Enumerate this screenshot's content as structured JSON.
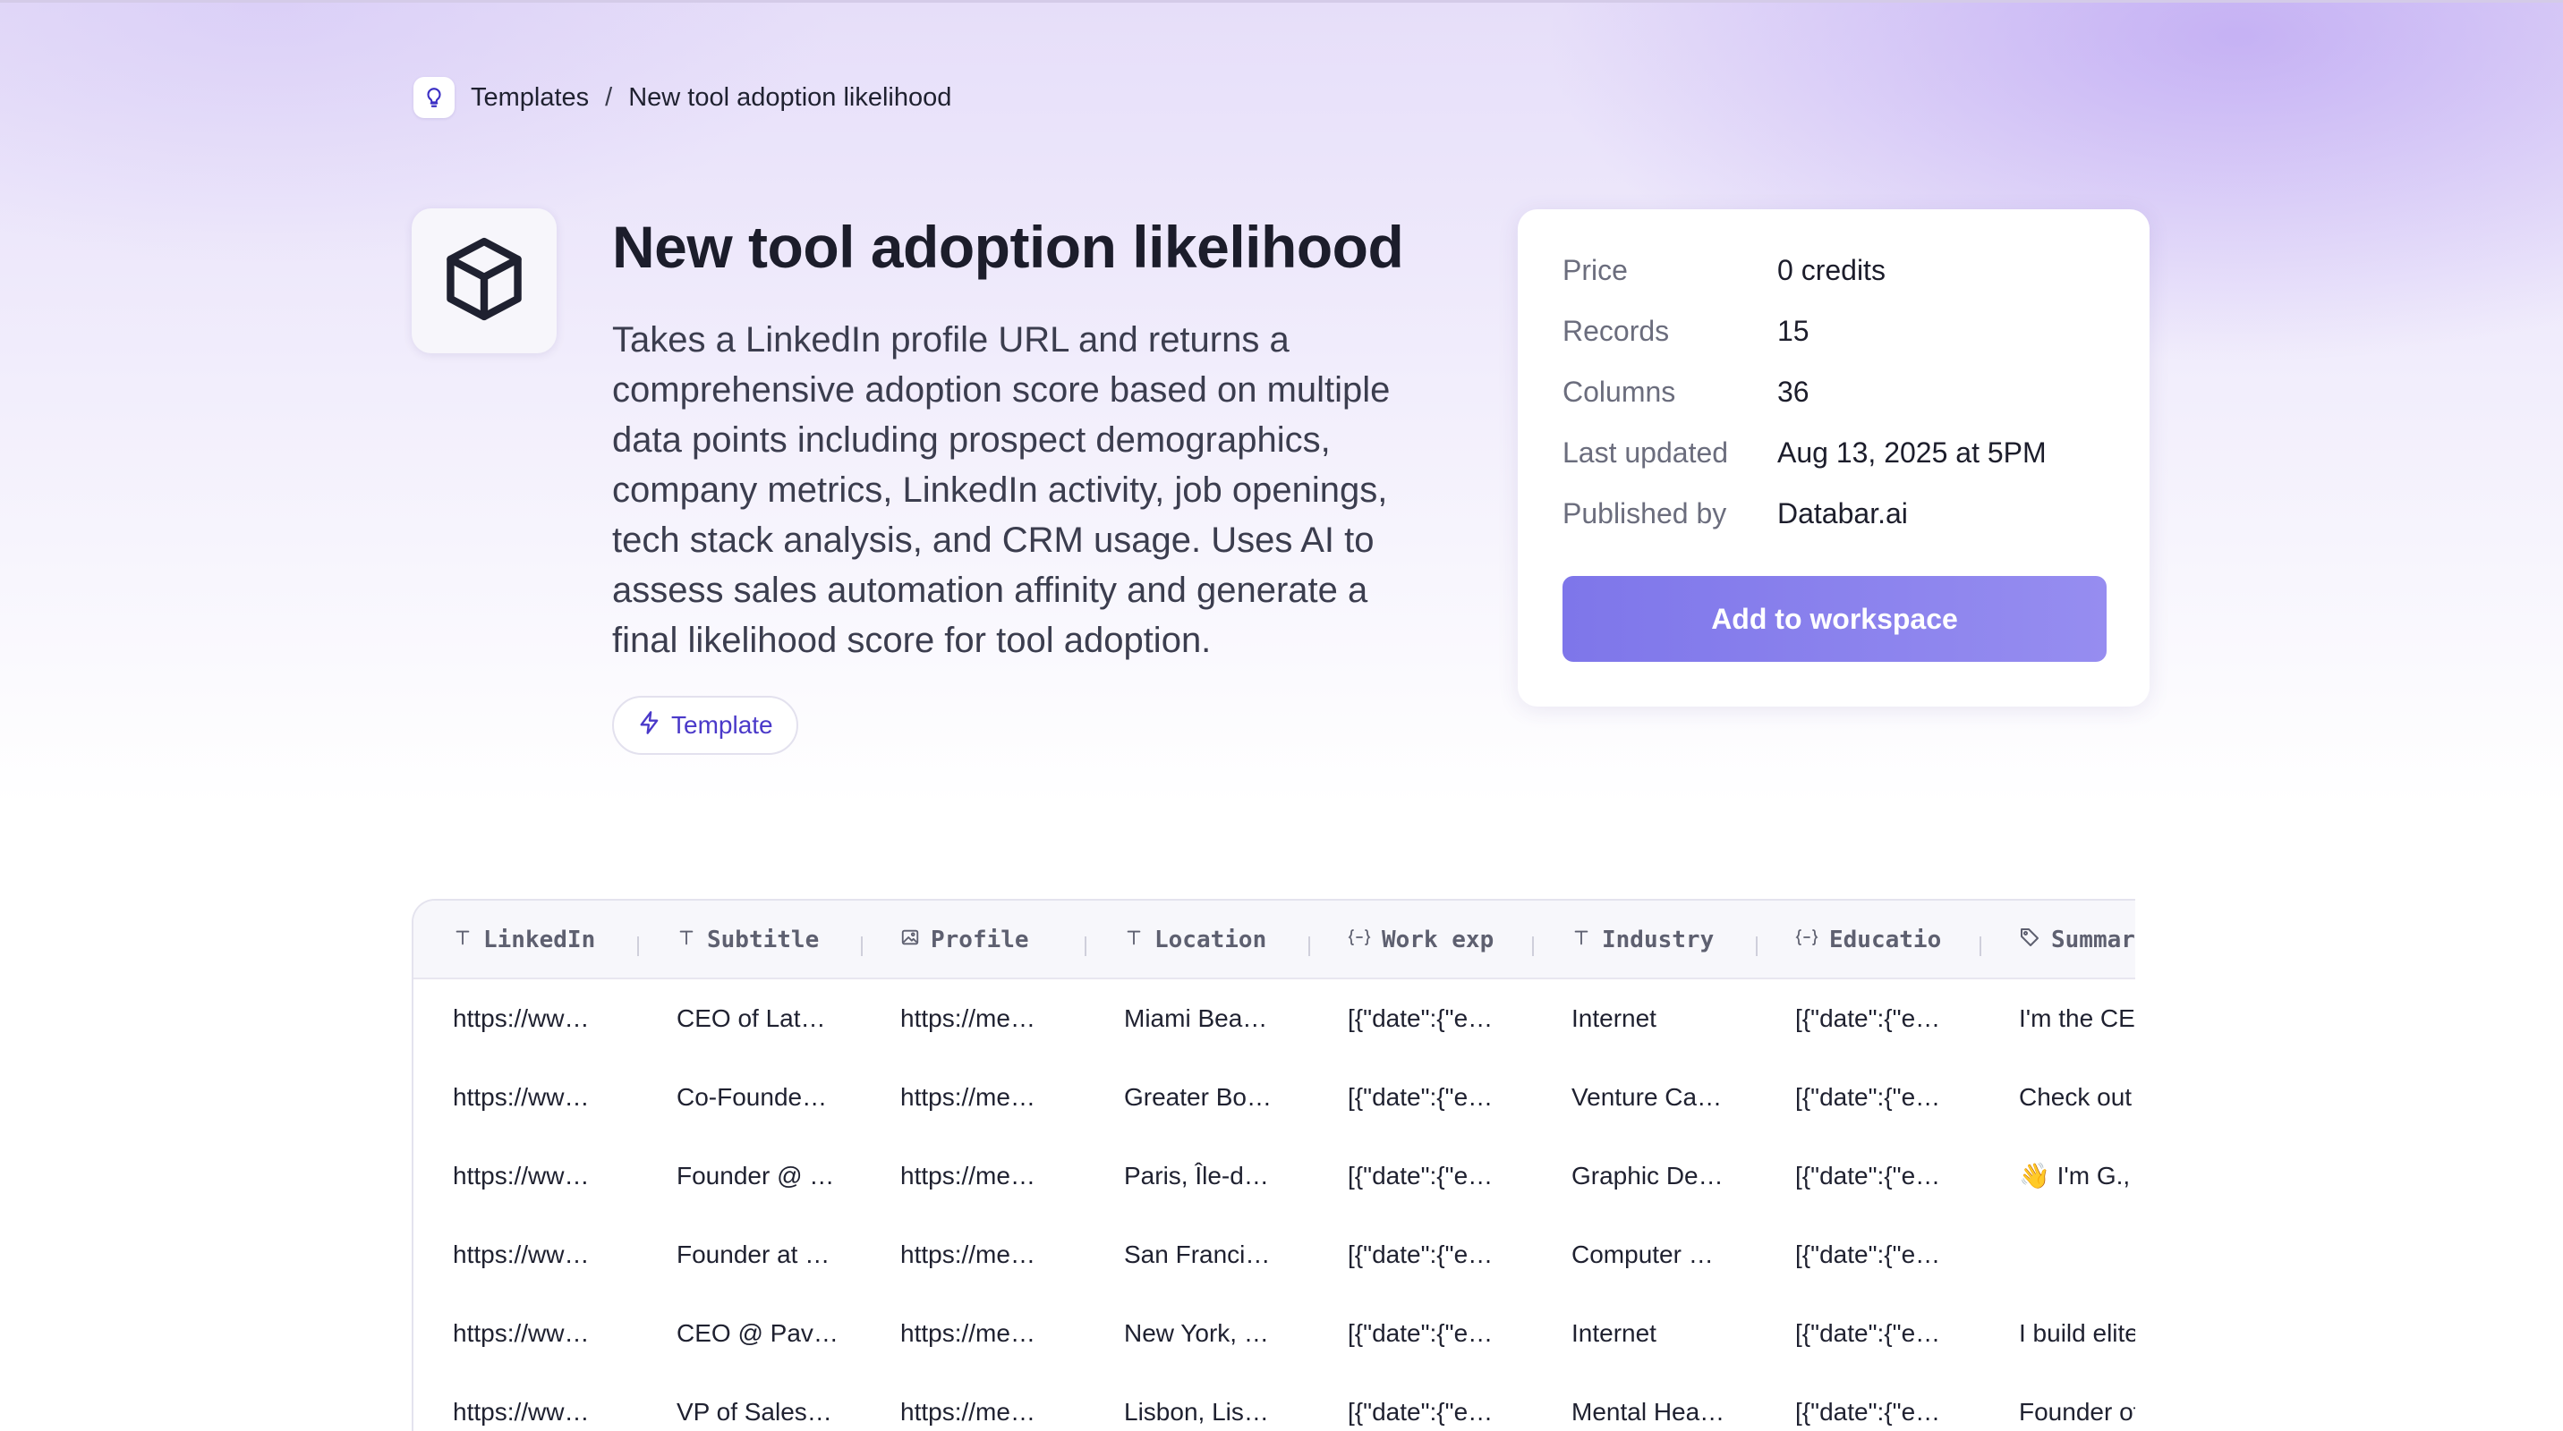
{
  "breadcrumb": {
    "icon": "lightbulb-icon",
    "parent": "Templates",
    "separator": "/",
    "current": "New tool adoption likelihood"
  },
  "hero": {
    "icon": "cube-icon",
    "title": "New tool adoption likelihood",
    "description": "Takes a LinkedIn profile URL and returns a comprehensive adoption score based on multiple data points including prospect demographics, company metrics, LinkedIn activity, job openings, tech stack analysis, and CRM usage. Uses AI to assess sales automation affinity and generate a final likelihood score for tool adoption.",
    "tag": {
      "icon": "lightning-icon",
      "label": "Template"
    }
  },
  "info": {
    "rows": [
      {
        "key": "Price",
        "value": "0 credits"
      },
      {
        "key": "Records",
        "value": "15"
      },
      {
        "key": "Columns",
        "value": "36"
      },
      {
        "key": "Last updated",
        "value": "Aug 13, 2025 at 5PM"
      },
      {
        "key": "Published by",
        "value": "Databar.ai"
      }
    ],
    "button": "Add to workspace"
  },
  "colors": {
    "accent": "#7e76ea",
    "accent_text": "#4a39c9"
  },
  "table": {
    "columns": [
      {
        "icon": "text-icon",
        "label": "LinkedIn"
      },
      {
        "icon": "text-icon",
        "label": "Subtitle"
      },
      {
        "icon": "image-icon",
        "label": "Profile"
      },
      {
        "icon": "text-icon",
        "label": "Location"
      },
      {
        "icon": "json-icon",
        "label": "Work exp"
      },
      {
        "icon": "text-icon",
        "label": "Industry"
      },
      {
        "icon": "json-icon",
        "label": "Educatio"
      },
      {
        "icon": "tag-icon",
        "label": "Summary"
      }
    ],
    "rows": [
      [
        "https://ww…",
        "CEO of Lat…",
        "https://me…",
        "Miami Bea…",
        "[{\"date\":{\"e…",
        "Internet",
        "[{\"date\":{\"e…",
        "I'm the CEO"
      ],
      [
        "https://ww…",
        "Co-Founde…",
        "https://me…",
        "Greater Bo…",
        "[{\"date\":{\"e…",
        "Venture Ca…",
        "[{\"date\":{\"e…",
        "Check out"
      ],
      [
        "https://ww…",
        "Founder @ …",
        "https://me…",
        "Paris, Île-d…",
        "[{\"date\":{\"e…",
        "Graphic De…",
        "[{\"date\":{\"e…",
        "👋 I'm G.,"
      ],
      [
        "https://ww…",
        "Founder at …",
        "https://me…",
        "San Franci…",
        "[{\"date\":{\"e…",
        "Computer …",
        "[{\"date\":{\"e…",
        ""
      ],
      [
        "https://ww…",
        "CEO @ Pav…",
        "https://me…",
        "New York, …",
        "[{\"date\":{\"e…",
        "Internet",
        "[{\"date\":{\"e…",
        "I build elite"
      ],
      [
        "https://ww…",
        "VP of Sales…",
        "https://me…",
        "Lisbon, Lis…",
        "[{\"date\":{\"e…",
        "Mental Hea…",
        "[{\"date\":{\"e…",
        "Founder of"
      ]
    ]
  }
}
